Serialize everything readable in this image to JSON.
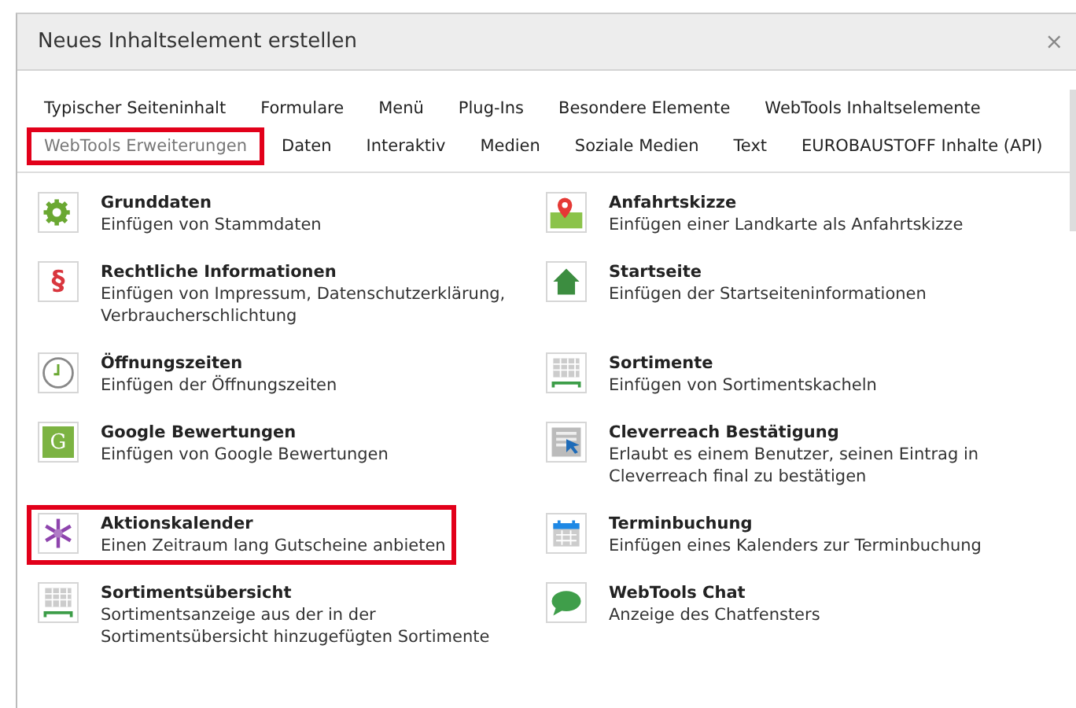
{
  "window": {
    "title": "Neues Inhaltselement erstellen",
    "close": "×"
  },
  "tabs": [
    {
      "label": "Typischer Seiteninhalt",
      "selected": false,
      "highlighted": false
    },
    {
      "label": "Formulare",
      "selected": false,
      "highlighted": false
    },
    {
      "label": "Menü",
      "selected": false,
      "highlighted": false
    },
    {
      "label": "Plug-Ins",
      "selected": false,
      "highlighted": false
    },
    {
      "label": "Besondere Elemente",
      "selected": false,
      "highlighted": false
    },
    {
      "label": "WebTools Inhaltselemente",
      "selected": false,
      "highlighted": false
    },
    {
      "label": "WebTools Erweiterungen",
      "selected": true,
      "highlighted": true
    },
    {
      "label": "Daten",
      "selected": false,
      "highlighted": false
    },
    {
      "label": "Interaktiv",
      "selected": false,
      "highlighted": false
    },
    {
      "label": "Medien",
      "selected": false,
      "highlighted": false
    },
    {
      "label": "Soziale Medien",
      "selected": false,
      "highlighted": false
    },
    {
      "label": "Text",
      "selected": false,
      "highlighted": false
    },
    {
      "label": "EUROBAUSTOFF Inhalte (API)",
      "selected": false,
      "highlighted": false
    }
  ],
  "items": [
    {
      "kind": "gear",
      "title": "Grunddaten",
      "description": "Einfügen von Stammdaten",
      "highlighted": false
    },
    {
      "kind": "map",
      "title": "Anfahrtskizze",
      "description": "Einfügen einer Landkarte als Anfahrtskizze",
      "highlighted": false
    },
    {
      "kind": "paragraph",
      "glyph": "§",
      "title": "Rechtliche Informationen",
      "description": "Einfügen von Impressum, Datenschutzerklärung, Verbraucherschlichtung",
      "highlighted": false
    },
    {
      "kind": "house",
      "title": "Startseite",
      "description": "Einfügen der Startseiteninformationen",
      "highlighted": false
    },
    {
      "kind": "clock",
      "title": "Öffnungszeiten",
      "description": "Einfügen der Öffnungszeiten",
      "highlighted": false
    },
    {
      "kind": "grid",
      "title": "Sortimente",
      "description": "Einfügen von Sortimentskacheln",
      "highlighted": false
    },
    {
      "kind": "google",
      "glyph": "G",
      "title": "Google Bewertungen",
      "description": "Einfügen von Google Bewertungen",
      "highlighted": false
    },
    {
      "kind": "cursor",
      "title": "Cleverreach Bestätigung",
      "description": "Erlaubt es einem Benutzer, seinen Eintrag in Cleverreach final zu bestätigen",
      "highlighted": false
    },
    {
      "kind": "snowflake",
      "title": "Aktionskalender",
      "description": "Einen Zeitraum lang Gutscheine anbieten",
      "highlighted": true
    },
    {
      "kind": "calendar",
      "title": "Terminbuchung",
      "description": "Einfügen eines Kalenders zur Terminbuchung",
      "highlighted": false
    },
    {
      "kind": "grid",
      "title": "Sortimentsübersicht",
      "description": "Sortimentsanzeige aus der in der Sortimentsübersicht hinzugefügten Sortimente",
      "highlighted": false
    },
    {
      "kind": "chat",
      "title": "WebTools Chat",
      "description": "Anzeige des Chatfensters",
      "highlighted": false
    }
  ]
}
